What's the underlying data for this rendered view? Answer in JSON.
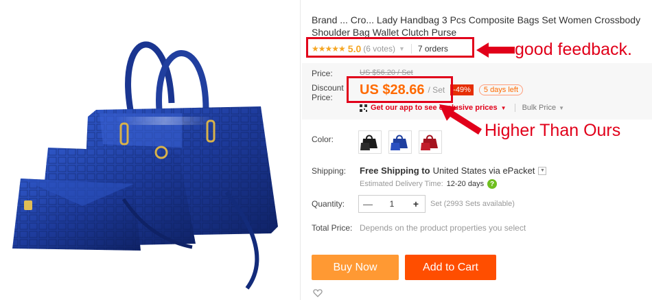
{
  "product": {
    "title": "Brand ... Cro... Lady Handbag 3 Pcs Composite Bags Set Women Crossbody Shoulder Bag Wallet Clutch Purse"
  },
  "rating": {
    "stars": "★★★★★",
    "score": "5.0",
    "votes": "(6 votes)",
    "orders": "7 orders"
  },
  "price": {
    "price_label": "Price:",
    "original": "US $56.20 / Set",
    "discount_label": "Discount Price:",
    "discount_price": "US $28.66",
    "unit": "/ Set",
    "discount_percent": "-49%",
    "days_left": "5 days left",
    "app_promo": "Get our app to see exclusive prices",
    "bulk_price": "Bulk Price"
  },
  "options": {
    "color_label": "Color:",
    "colors": [
      "black",
      "blue",
      "red"
    ]
  },
  "shipping": {
    "label": "Shipping:",
    "free": "Free Shipping to",
    "destination": "United States via ePacket",
    "delivery_label": "Estimated Delivery Time:",
    "delivery_value": "12-20 days"
  },
  "quantity": {
    "label": "Quantity:",
    "minus": "—",
    "value": "1",
    "plus": "+",
    "available": "Set (2993 Sets available)"
  },
  "total": {
    "label": "Total Price:",
    "value": "Depends on the product properties you select"
  },
  "actions": {
    "buy_now": "Buy Now",
    "add_to_cart": "Add to Cart"
  },
  "annotations": {
    "feedback_note": "good feedback.",
    "price_note": "Higher Than Ours"
  },
  "colors": {
    "accent_orange": "#ff6a00",
    "annotation_red": "#e1001a",
    "buy_now": "#ff9933",
    "add_to_cart": "#ff4e00",
    "bag_blue": "#1f3f9f"
  }
}
